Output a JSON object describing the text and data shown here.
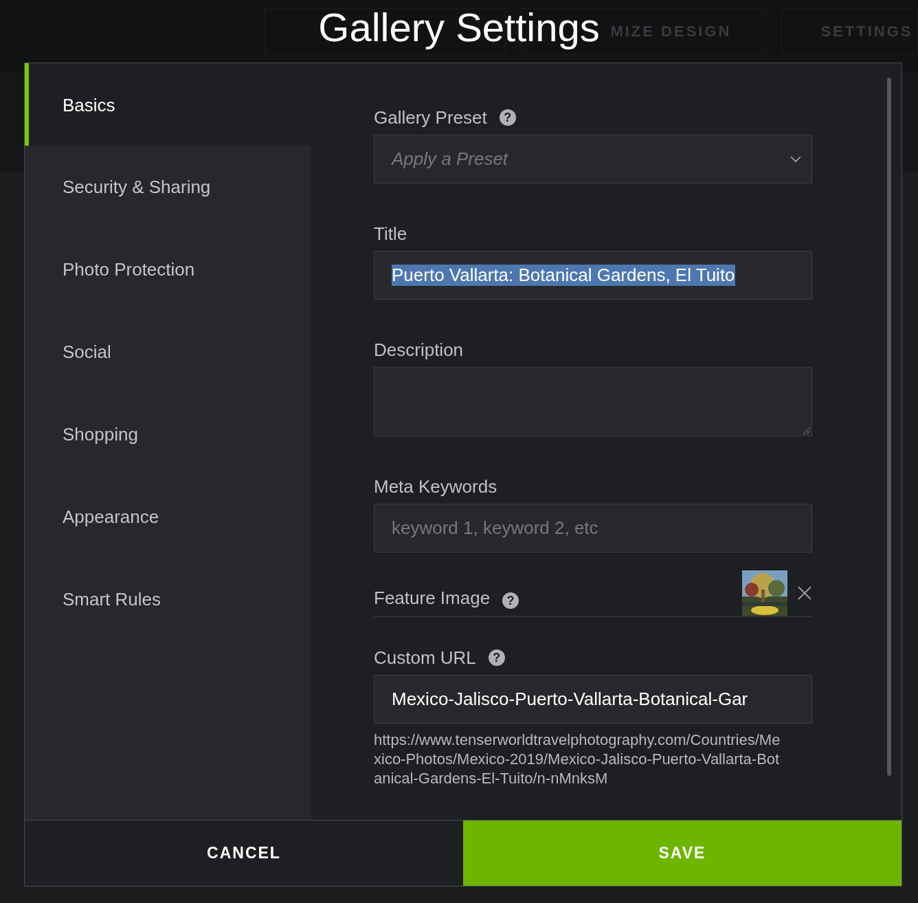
{
  "background_tabs": [
    {
      "label": "MIZE DESIGN"
    },
    {
      "label": "SETTINGS"
    }
  ],
  "dialog": {
    "title": "Gallery Settings"
  },
  "sidebar": {
    "items": [
      {
        "label": "Basics",
        "selected": true
      },
      {
        "label": "Security & Sharing",
        "selected": false
      },
      {
        "label": "Photo Protection",
        "selected": false
      },
      {
        "label": "Social",
        "selected": false
      },
      {
        "label": "Shopping",
        "selected": false
      },
      {
        "label": "Appearance",
        "selected": false
      },
      {
        "label": "Smart Rules",
        "selected": false
      }
    ]
  },
  "fields": [
    {
      "kind": "dropdown",
      "label": "Gallery Preset",
      "help": "?",
      "placeholder": "Apply a Preset"
    },
    {
      "kind": "text",
      "label": "Title",
      "value": "Puerto Vallarta: Botanical Gardens, El Tuito",
      "text_selected": true
    },
    {
      "kind": "textarea",
      "label": "Description"
    },
    {
      "kind": "text",
      "label": "Meta Keywords",
      "placeholder": "keyword 1, keyword 2, etc"
    },
    {
      "label": "Feature Image",
      "help": "?"
    },
    {
      "kind": "text",
      "label": "Custom URL",
      "help": "?",
      "value": "Mexico-Jalisco-Puerto-Vallarta-Botanical-Gar",
      "note": "https://www.tenserworldtravelphotography.com/Countries/Mexico-Photos/Mexico-2019/Mexico-Jalisco-Puerto-Vallarta-Botanical-Gardens-El-Tuito/n-nMnksM"
    }
  ],
  "buttons": [
    {
      "label": "CANCEL",
      "kind": "secondary"
    },
    {
      "label": "SAVE",
      "kind": "primary"
    }
  ]
}
